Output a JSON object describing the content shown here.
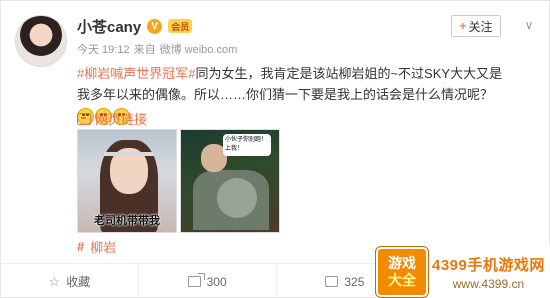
{
  "user": {
    "name": "小苍cany",
    "verified_badge": "V",
    "level_badge": "会员"
  },
  "meta": {
    "time": "今天 19:12",
    "source_prefix": "来自",
    "source": "微博 weibo.com"
  },
  "header": {
    "follow_plus": "+",
    "follow_label": "关注",
    "menu_icon": "chevron-down-icon",
    "menu_glyph": "∨"
  },
  "post": {
    "topic": "#柳岩喊声世界冠军#",
    "text": "同为女生，我肯定是该站柳岩姐的~不过SKY大大又是我多年以来的偶像。所以……你们猜一下要是我上的话会是什么情况呢？",
    "emojis": [
      "smile-emoji",
      "smile-emoji",
      "smile-emoji"
    ]
  },
  "link": {
    "label": "网页链接"
  },
  "photos": {
    "photo1_caption": "老司机带带我",
    "photo2_bubble": "小伙子你别跑！上我！"
  },
  "tag": {
    "icon": "#",
    "label": "柳岩"
  },
  "actions": {
    "favorite_label": "收藏",
    "repost_count": "300",
    "comment_count": "325"
  },
  "watermark": {
    "box_top": "游戏",
    "box_bottom": "大全",
    "main": "4399手机游戏网",
    "url": "www.4399.cn"
  },
  "colors": {
    "accent": "#eb7350",
    "follow_plus": "#ff8140",
    "verified": "#f6a623",
    "logo_orange": "#f38a00"
  }
}
